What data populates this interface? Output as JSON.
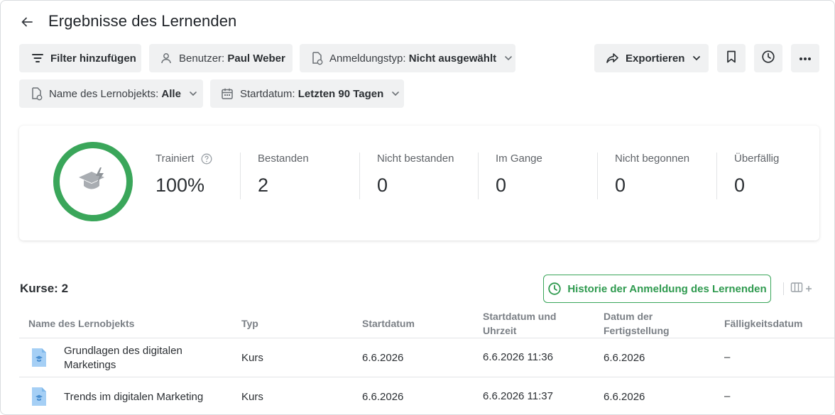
{
  "header": {
    "title": "Ergebnisse des Lernenden"
  },
  "filters": {
    "add_filter": "Filter hinzufügen",
    "user_label": "Benutzer:",
    "user_value": "Paul Weber",
    "enrollment_label": "Anmeldungstyp:",
    "enrollment_value": "Nicht ausgewählt",
    "lo_label": "Name des Lernobjekts:",
    "lo_value": "Alle",
    "start_label": "Startdatum:",
    "start_value": "Letzten 90 Tagen"
  },
  "toolbar": {
    "export_label": "Exportieren",
    "icons": [
      "bookmark-icon",
      "history-icon",
      "more-icon"
    ]
  },
  "summary": {
    "trained_label": "Trainiert",
    "trained_value": "100%",
    "passed_label": "Bestanden",
    "passed_value": "2",
    "failed_label": "Nicht bestanden",
    "failed_value": "0",
    "inprogress_label": "Im Gange",
    "inprogress_value": "0",
    "notstarted_label": "Nicht begonnen",
    "notstarted_value": "0",
    "overdue_label": "Überfällig",
    "overdue_value": "0",
    "ring_color": "#3aa65a"
  },
  "table": {
    "count_label": "Kurse: 2",
    "history_button": "Historie der Anmeldung des Lernenden",
    "headers": {
      "name": "Name des Lernobjekts",
      "type": "Typ",
      "start": "Startdatum",
      "start_time_1": "Startdatum und",
      "start_time_2": "Uhrzeit",
      "completed_1": "Datum der",
      "completed_2": "Fertigstellung",
      "due": "Fälligkeitsdatum"
    },
    "rows": [
      {
        "name_1": "Grundlagen des digitalen",
        "name_2": "Marketings",
        "type": "Kurs",
        "start": "6.6.2026",
        "start_time": "6.6.2026 11:36",
        "completed": "6.6.2026",
        "due": "–"
      },
      {
        "name_1": "Trends im digitalen Marketing",
        "type": "Kurs",
        "start": "6.6.2026",
        "start_time": "6.6.2026 11:37",
        "completed": "6.6.2026",
        "due": "–"
      }
    ]
  }
}
